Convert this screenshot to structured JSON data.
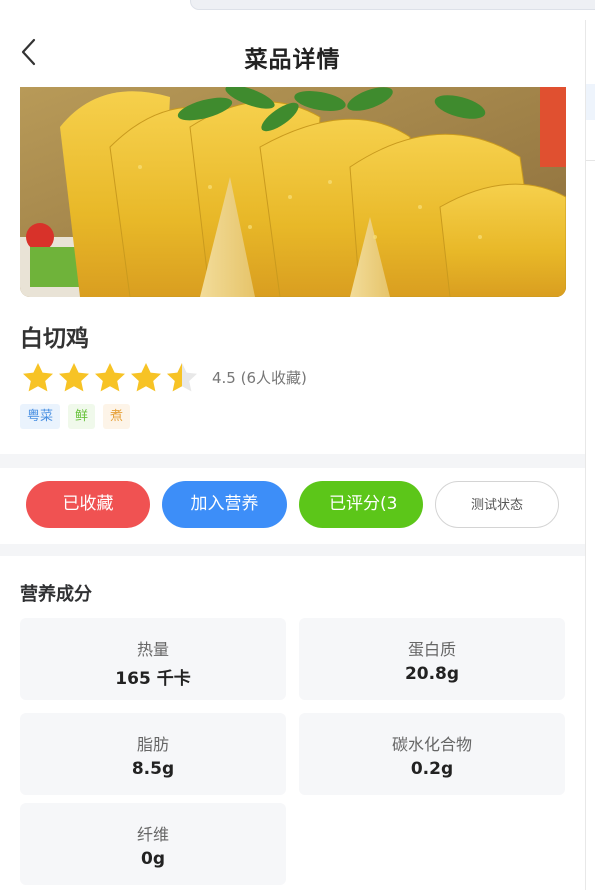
{
  "header": {
    "title": "菜品详情"
  },
  "dish": {
    "name": "白切鸡",
    "rating": 4.5,
    "max_rating": 5,
    "rating_text": "4.5 (6人收藏)",
    "tags": [
      "粤菜",
      "鲜",
      "煮"
    ]
  },
  "actions": {
    "favorite_label": "已收藏",
    "nutrition_label": "加入营养",
    "rated_label": "已评分(3",
    "test_label": "测试状态"
  },
  "nutrition": {
    "title": "营养成分",
    "items": [
      {
        "label": "热量",
        "value": "165 千卡"
      },
      {
        "label": "蛋白质",
        "value": "20.8g"
      },
      {
        "label": "脂肪",
        "value": "8.5g"
      },
      {
        "label": "碳水化合物",
        "value": "0.2g"
      },
      {
        "label": "纤维",
        "value": "0g"
      }
    ]
  },
  "colors": {
    "favorite": "#f05252",
    "nutrition": "#3d8ef8",
    "rated": "#5cc619",
    "star": "#f7c325"
  }
}
